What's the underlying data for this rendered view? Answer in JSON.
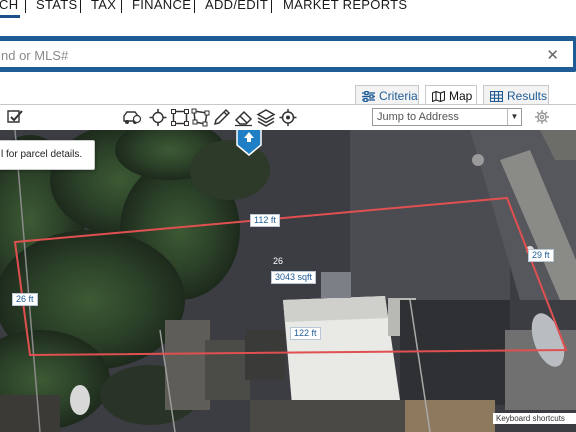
{
  "nav": {
    "items": [
      "CH",
      "STATS",
      "TAX",
      "FINANCE",
      "ADD/EDIT",
      "MARKET REPORTS"
    ]
  },
  "search": {
    "placeholder": "nd or MLS#",
    "clear_icon": "close-icon"
  },
  "tabs": [
    {
      "label": "Criteria",
      "icon": "sliders-icon",
      "active": false
    },
    {
      "label": "Map",
      "icon": "map-icon",
      "active": true
    },
    {
      "label": "Results",
      "icon": "grid-icon",
      "active": false
    }
  ],
  "toolbar": {
    "tools": [
      "select-parcel-icon",
      "streetview-car-icon",
      "pan-icon",
      "draw-rectangle-icon",
      "draw-polygon-icon",
      "draw-freehand-icon",
      "eraser-icon",
      "layers-icon",
      "locate-icon"
    ],
    "jump_placeholder": "Jump to Address",
    "settings_icon": "gear-icon"
  },
  "map": {
    "tooltip": "l for parcel details.",
    "parcel_number": "26",
    "dimensions": {
      "top": "112 ft",
      "left": "26 ft",
      "right": "29 ft",
      "bottom": "122 ft",
      "area": "3043 sqft"
    },
    "footer": "Keyboard shortcuts",
    "parcel_color": "#e05050"
  }
}
